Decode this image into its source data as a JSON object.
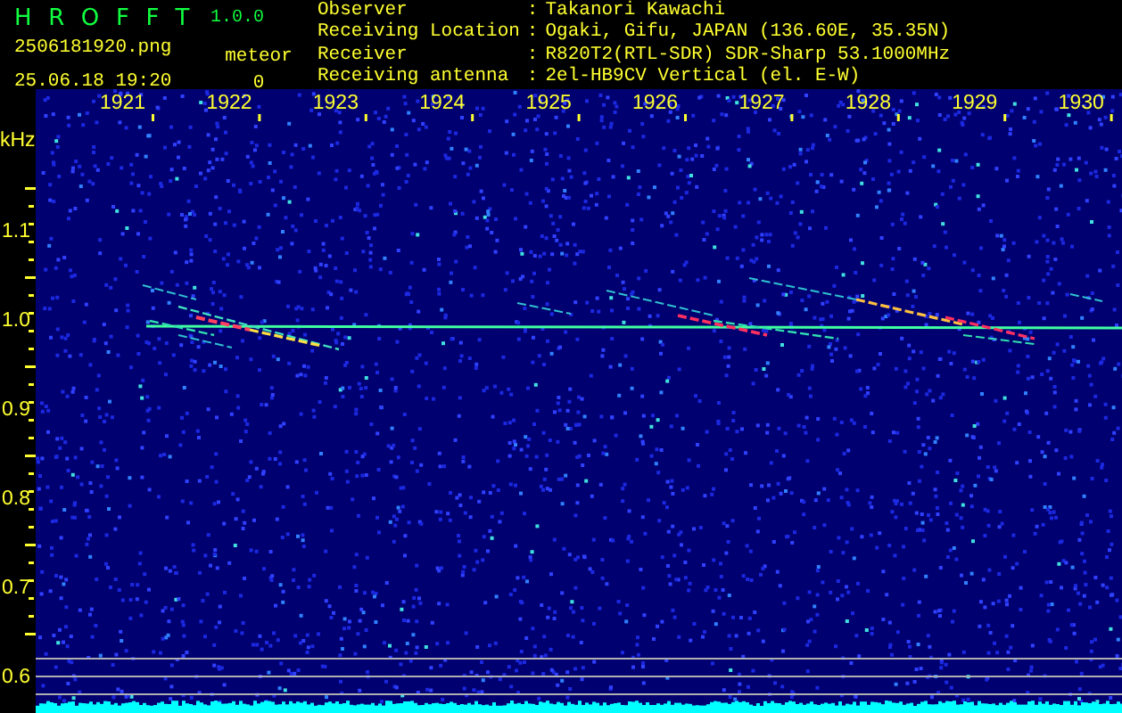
{
  "app": {
    "title": "HROFFT",
    "version": "1.0.0"
  },
  "file": {
    "name": "2506181920.png",
    "datetime": "25.06.18 19:20"
  },
  "meteor": {
    "label": "meteor",
    "count": "0"
  },
  "info": [
    {
      "label": "Observer",
      "separator": ":",
      "value": "Takanori Kawachi"
    },
    {
      "label": "Receiving Location",
      "separator": ":",
      "value": "Ogaki, Gifu, JAPAN (136.60E, 35.35N)"
    },
    {
      "label": "Receiver",
      "separator": ":",
      "value": "R820T2(RTL-SDR) SDR-Sharp 53.1000MHz"
    },
    {
      "label": "Receiving antenna",
      "separator": ":",
      "value": "2el-HB9CV Vertical (el. E-W)"
    }
  ],
  "plot": {
    "unit": "kHz",
    "time_ticks": [
      "1921",
      "1922",
      "1923",
      "1924",
      "1925",
      "1926",
      "1927",
      "1928",
      "1929",
      "1930"
    ],
    "freq_ticks": [
      "1.1",
      "1.0",
      "0.9",
      "0.8",
      "0.7",
      "0.6"
    ]
  }
}
